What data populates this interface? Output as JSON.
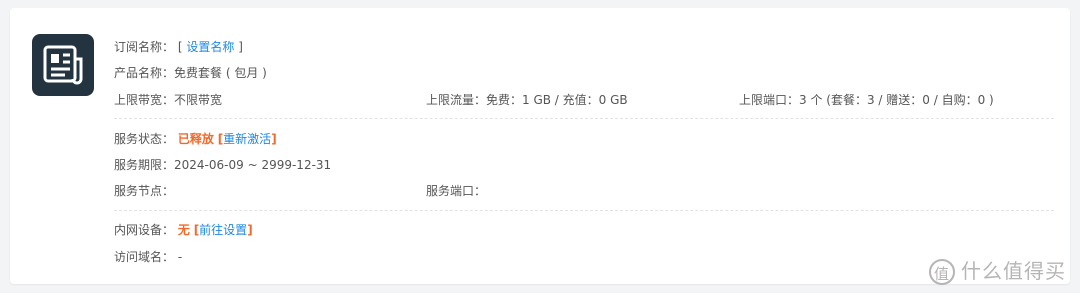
{
  "subscription": {
    "name_label": "订阅名称：",
    "name_link": "设置名称",
    "product_label": "产品名称：",
    "product_value": "免费套餐 ( 包月 )",
    "bandwidth_label": "上限带宽：",
    "bandwidth_value": "不限带宽",
    "traffic_label": "上限流量：",
    "traffic_value": "免费：1 GB / 充值：0 GB",
    "ports_label": "上限端口：",
    "ports_value": "3 个 (套餐：3 / 赠送：0 / 自购：0 )"
  },
  "service": {
    "status_label": "服务状态：",
    "status_value": "已释放",
    "reactivate_link": "重新激活",
    "period_label": "服务期限：",
    "period_value": "2024-06-09 ~ 2999-12-31",
    "node_label": "服务节点：",
    "node_value": "",
    "port_label": "服务端口：",
    "port_value": ""
  },
  "intranet": {
    "device_label": "内网设备：",
    "device_value": "无",
    "goto_settings_link": "前往设置",
    "domain_label": "访问域名：",
    "domain_value": "-"
  },
  "watermark": {
    "icon_glyph": "值",
    "text": "什么值得买"
  },
  "brackets": {
    "open": "[",
    "close": "]"
  },
  "colors": {
    "link": "#1e88e5",
    "warning": "#f26a2a",
    "logo_bg": "#233440"
  }
}
